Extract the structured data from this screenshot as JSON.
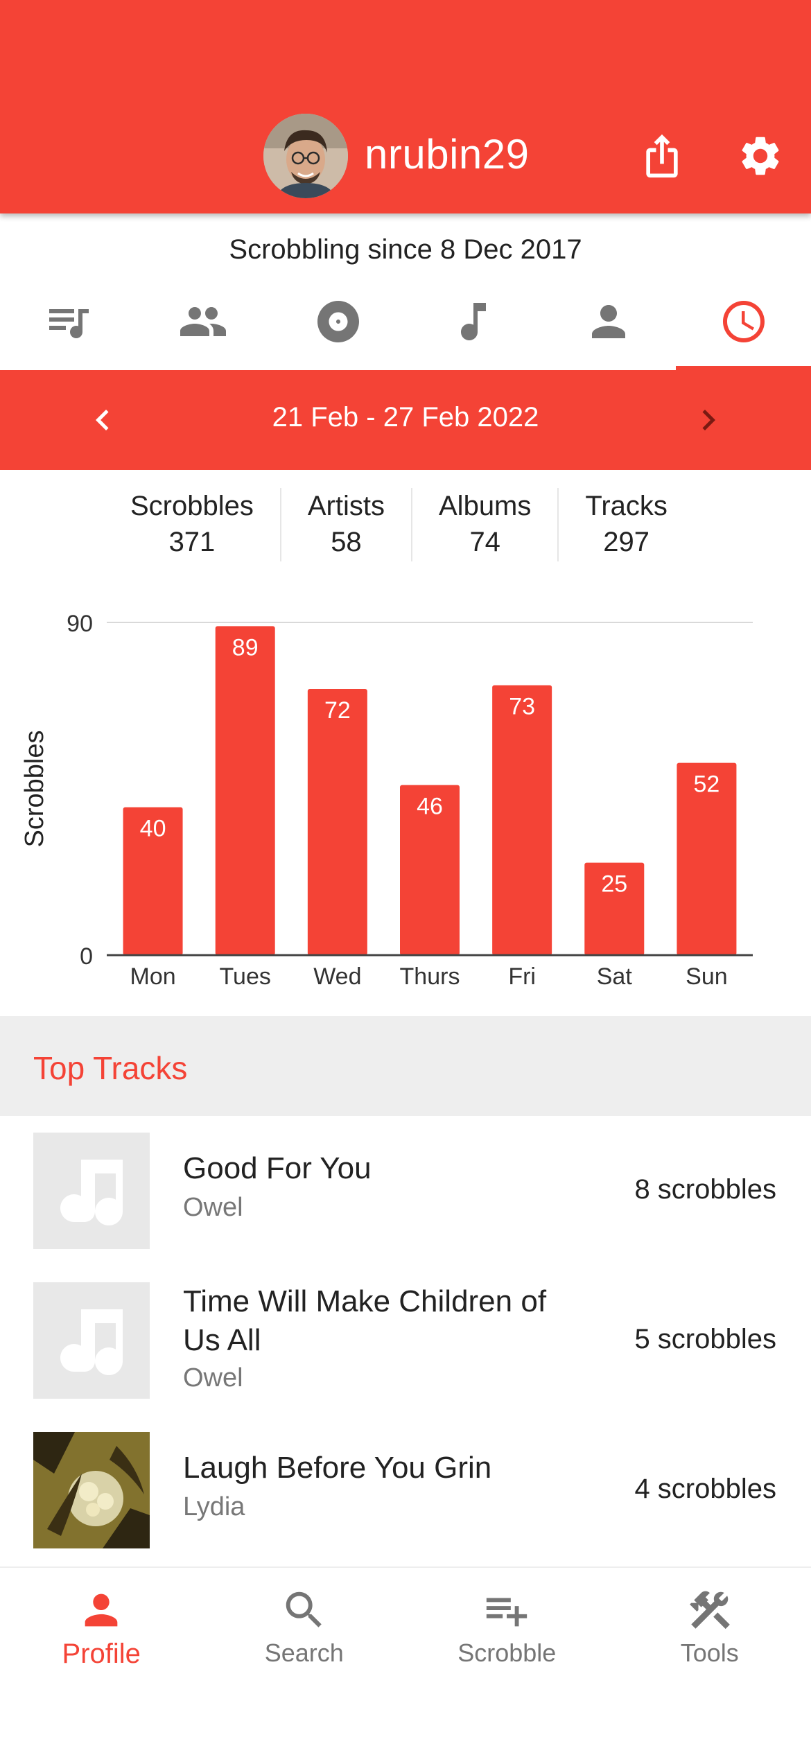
{
  "header": {
    "username": "nrubin29",
    "colors": {
      "primary": "#f44336"
    },
    "icons": {
      "share": "share-icon",
      "settings": "gear-icon"
    }
  },
  "profile": {
    "since": "Scrobbling since 8 Dec 2017"
  },
  "tabs": [
    {
      "icon": "playlist-music-icon",
      "active": false
    },
    {
      "icon": "people-icon",
      "active": false
    },
    {
      "icon": "album-disc-icon",
      "active": false
    },
    {
      "icon": "music-note-icon",
      "active": false
    },
    {
      "icon": "person-icon",
      "active": false
    },
    {
      "icon": "clock-icon",
      "active": true
    }
  ],
  "date_range": {
    "label": "21 Feb - 27 Feb 2022"
  },
  "stats": [
    {
      "label": "Scrobbles",
      "value": "371"
    },
    {
      "label": "Artists",
      "value": "58"
    },
    {
      "label": "Albums",
      "value": "74"
    },
    {
      "label": "Tracks",
      "value": "297"
    }
  ],
  "chart_data": {
    "type": "bar",
    "categories": [
      "Mon",
      "Tues",
      "Wed",
      "Thurs",
      "Fri",
      "Sat",
      "Sun"
    ],
    "values": [
      40,
      89,
      72,
      46,
      73,
      25,
      52
    ],
    "ylabel": "Scrobbles",
    "ylim": [
      0,
      90
    ],
    "yticks": [
      "90",
      "0"
    ],
    "color": "#f44336",
    "data_labels": true
  },
  "top_tracks": {
    "title": "Top Tracks",
    "items": [
      {
        "title": "Good For You",
        "artist": "Owel",
        "count": "8 scrobbles",
        "art": "music-note-placeholder"
      },
      {
        "title": "Time Will Make Children of Us All",
        "artist": "Owel",
        "count": "5 scrobbles",
        "art": "music-note-placeholder"
      },
      {
        "title": "Laugh Before You Grin",
        "artist": "Lydia",
        "count": "4 scrobbles",
        "art": "album-cover"
      }
    ]
  },
  "bottom_nav": [
    {
      "label": "Profile",
      "icon": "person-icon",
      "active": true
    },
    {
      "label": "Search",
      "icon": "search-icon",
      "active": false
    },
    {
      "label": "Scrobble",
      "icon": "playlist-add-icon",
      "active": false
    },
    {
      "label": "Tools",
      "icon": "tools-icon",
      "active": false
    }
  ]
}
